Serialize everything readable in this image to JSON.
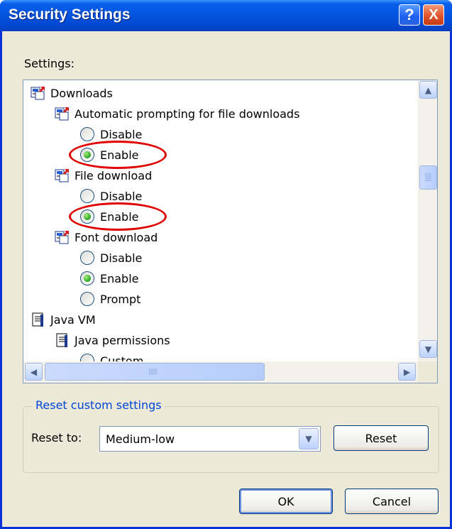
{
  "window": {
    "title": "Security Settings",
    "help_glyph": "?",
    "close_glyph": "X"
  },
  "settings": {
    "label": "Settings:"
  },
  "tree": [
    {
      "type": "category",
      "label": "Downloads",
      "icon": "settings-category-icon"
    },
    {
      "type": "setting",
      "label": "Automatic prompting for file downloads",
      "icon": "settings-category-icon"
    },
    {
      "type": "option",
      "label": "Disable",
      "checked": false
    },
    {
      "type": "option",
      "label": "Enable",
      "checked": true,
      "highlighted": true
    },
    {
      "type": "setting",
      "label": "File download",
      "icon": "settings-category-icon"
    },
    {
      "type": "option",
      "label": "Disable",
      "checked": false
    },
    {
      "type": "option",
      "label": "Enable",
      "checked": true,
      "highlighted": true
    },
    {
      "type": "setting",
      "label": "Font download",
      "icon": "settings-category-icon"
    },
    {
      "type": "option",
      "label": "Disable",
      "checked": false
    },
    {
      "type": "option",
      "label": "Enable",
      "checked": true
    },
    {
      "type": "option",
      "label": "Prompt",
      "checked": false
    },
    {
      "type": "category",
      "label": "Java VM",
      "icon": "document-icon"
    },
    {
      "type": "setting",
      "label": "Java permissions",
      "icon": "document-icon"
    },
    {
      "type": "option",
      "label": "Custom",
      "checked": false
    }
  ],
  "reset_group": {
    "legend": "Reset custom settings",
    "reset_to_label": "Reset to:",
    "selected": "Medium-low",
    "reset_button": "Reset"
  },
  "buttons": {
    "ok": "OK",
    "cancel": "Cancel"
  },
  "colors": {
    "highlight_ellipse": "#e00000",
    "titlebar": "#0455e0",
    "legend_text": "#0046d5"
  }
}
